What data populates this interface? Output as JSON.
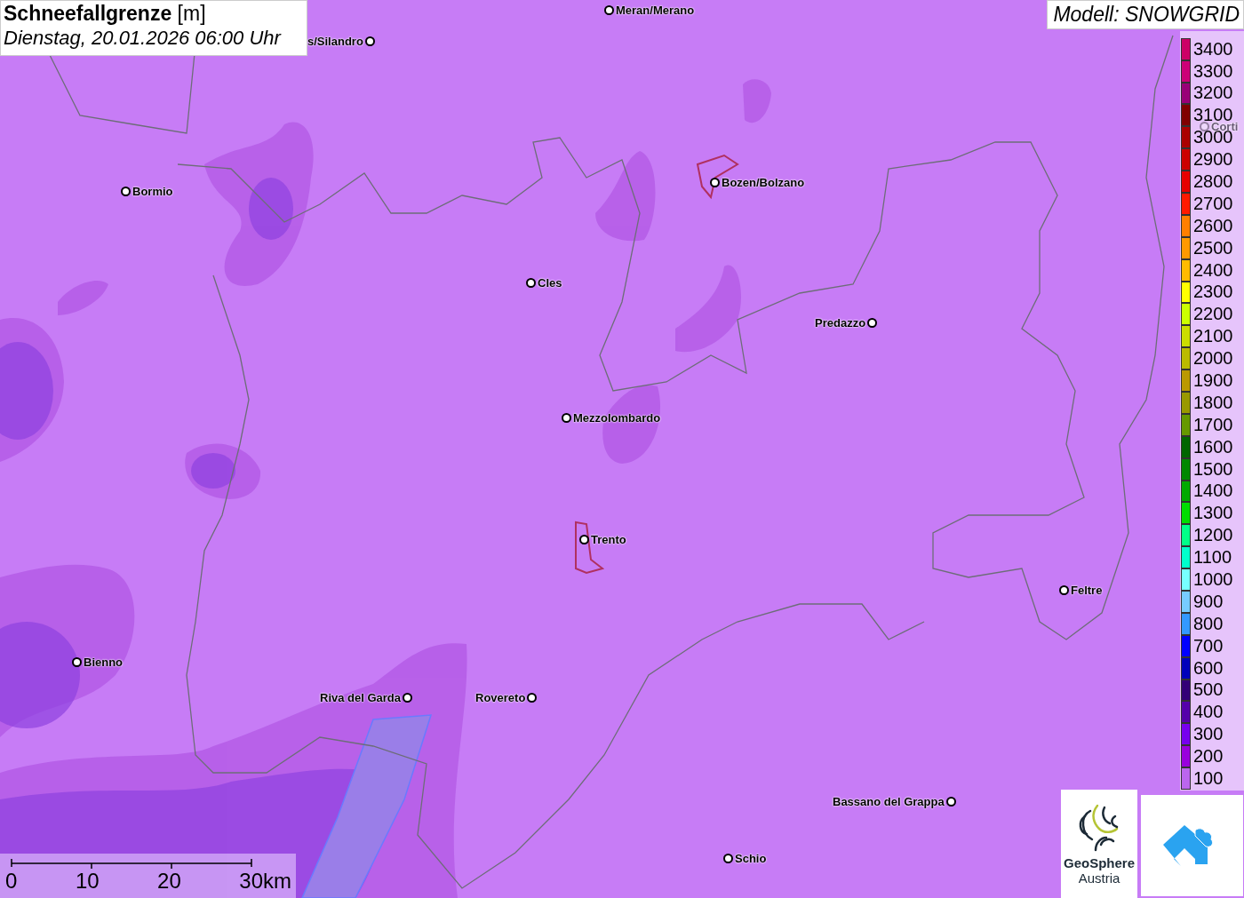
{
  "title": {
    "name": "Schneefallgrenze",
    "unit": "[m]",
    "timestamp": "Dienstag, 20.01.2026 06:00 Uhr"
  },
  "model": "Modell: SNOWGRID",
  "cities": [
    {
      "name": "Meran/Merano"
    },
    {
      "name": "s/Silandro"
    },
    {
      "name": "Bormio"
    },
    {
      "name": "Bozen/Bolzano"
    },
    {
      "name": "Cles"
    },
    {
      "name": "Predazzo"
    },
    {
      "name": "Mezzolombardo"
    },
    {
      "name": "Trento"
    },
    {
      "name": "Feltre"
    },
    {
      "name": "Bienno"
    },
    {
      "name": "Riva del Garda"
    },
    {
      "name": "Rovereto"
    },
    {
      "name": "Bassano del Grappa"
    },
    {
      "name": "Schio"
    },
    {
      "name": "Corti"
    }
  ],
  "legend": [
    {
      "label": "3400",
      "color": "#cc0066"
    },
    {
      "label": "3300",
      "color": "#cc0077"
    },
    {
      "label": "3200",
      "color": "#990077"
    },
    {
      "label": "3100",
      "color": "#800000"
    },
    {
      "label": "3000",
      "color": "#aa0000"
    },
    {
      "label": "2900",
      "color": "#cc0000"
    },
    {
      "label": "2800",
      "color": "#e60000"
    },
    {
      "label": "2700",
      "color": "#ff1a00"
    },
    {
      "label": "2600",
      "color": "#ff7f00"
    },
    {
      "label": "2500",
      "color": "#ff9900"
    },
    {
      "label": "2400",
      "color": "#ffbb00"
    },
    {
      "label": "2300",
      "color": "#ffff00"
    },
    {
      "label": "2200",
      "color": "#ccff00"
    },
    {
      "label": "2100",
      "color": "#ccdd00"
    },
    {
      "label": "2000",
      "color": "#bbbb00"
    },
    {
      "label": "1900",
      "color": "#bb9900"
    },
    {
      "label": "1800",
      "color": "#999900"
    },
    {
      "label": "1700",
      "color": "#669900"
    },
    {
      "label": "1600",
      "color": "#006600"
    },
    {
      "label": "1500",
      "color": "#008800"
    },
    {
      "label": "1400",
      "color": "#00aa00"
    },
    {
      "label": "1300",
      "color": "#00dd00"
    },
    {
      "label": "1200",
      "color": "#00ff88"
    },
    {
      "label": "1100",
      "color": "#00ffcc"
    },
    {
      "label": "1000",
      "color": "#77ffff"
    },
    {
      "label": "900",
      "color": "#77ccff"
    },
    {
      "label": "800",
      "color": "#3399ff"
    },
    {
      "label": "700",
      "color": "#0000ff"
    },
    {
      "label": "600",
      "color": "#0000bb"
    },
    {
      "label": "500",
      "color": "#330077"
    },
    {
      "label": "400",
      "color": "#5500aa"
    },
    {
      "label": "300",
      "color": "#7700ee"
    },
    {
      "label": "200",
      "color": "#9900dd"
    },
    {
      "label": "100",
      "color": "#bb66ee"
    }
  ],
  "scale": {
    "ticks": [
      "0",
      "10",
      "20",
      "30km"
    ]
  },
  "logo": {
    "name": "GeoSphere",
    "country": "Austria"
  }
}
